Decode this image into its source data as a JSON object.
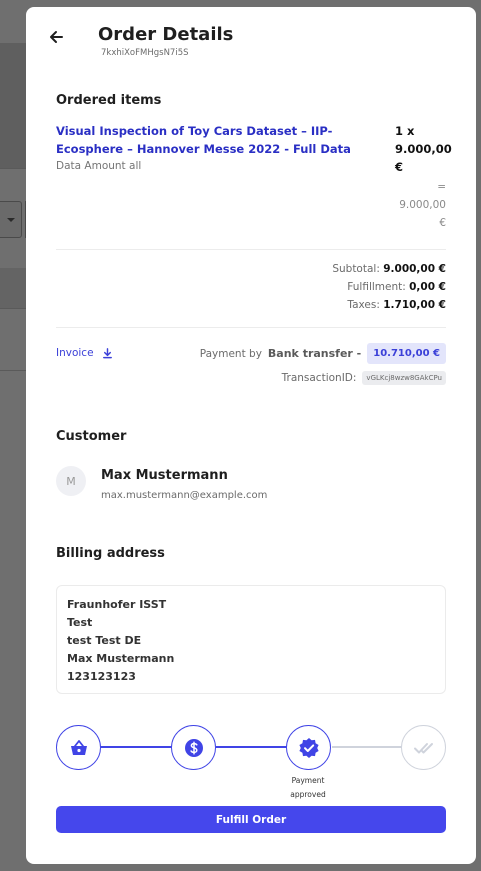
{
  "header": {
    "title": "Order Details",
    "order_id": "7kxhiXoFMHgsN7i5S"
  },
  "ordered_items": {
    "heading": "Ordered items",
    "items": [
      {
        "name": "Visual Inspection of Toy Cars Dataset – IIP-Ecosphere – Hannover Messe 2022 - Full Data",
        "subtitle": "Data Amount all",
        "qty_prefix": "1 x",
        "unit_price": "9.000,00",
        "unit_currency": "€",
        "eq_sign": "=",
        "line_total": "9.000,00",
        "line_currency": "€"
      }
    ]
  },
  "totals": {
    "subtotal_label": "Subtotal:",
    "subtotal_value": "9.000,00 €",
    "fulfillment_label": "Fulfillment:",
    "fulfillment_value": "0,00 €",
    "taxes_label": "Taxes:",
    "taxes_value": "1.710,00 €"
  },
  "payment": {
    "invoice_label": "Invoice",
    "payment_by_label": "Payment by",
    "method": "Bank transfer -",
    "amount": "10.710,00 €",
    "transaction_label": "TransactionID:",
    "transaction_id": "vGLKcj8wzw8GAkCPu"
  },
  "customer": {
    "heading": "Customer",
    "avatar_initial": "M",
    "name": "Max Mustermann",
    "email": "max.mustermann@example.com"
  },
  "billing": {
    "heading": "Billing address",
    "lines": [
      "Fraunhofer ISST",
      "Test",
      "test Test DE",
      "Max Mustermann",
      "123123123"
    ]
  },
  "progress": {
    "steps": [
      {
        "icon": "basket-icon",
        "state": "complete"
      },
      {
        "icon": "dollar-icon",
        "state": "complete"
      },
      {
        "icon": "badge-check-icon",
        "state": "current",
        "label_line1": "Payment",
        "label_line2": "approved"
      },
      {
        "icon": "double-check-icon",
        "state": "pending"
      }
    ],
    "accent_color": "#4044e6",
    "pending_color": "#cfd3dc"
  },
  "actions": {
    "fulfill_label": "Fulfill Order"
  }
}
